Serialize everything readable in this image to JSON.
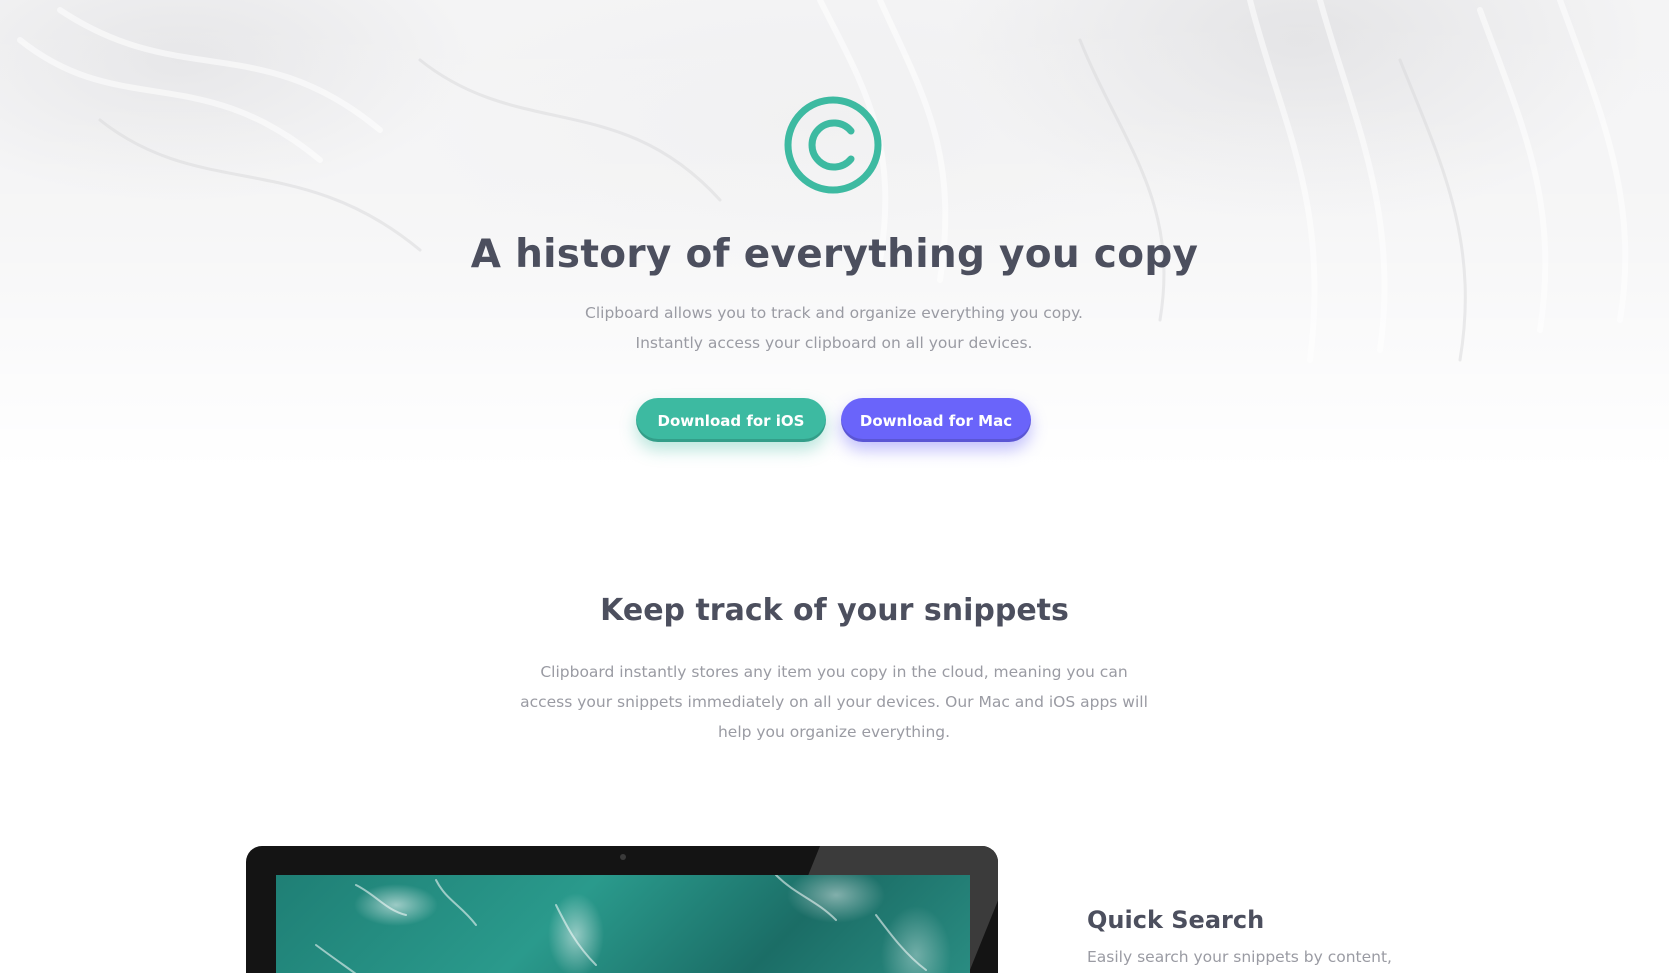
{
  "hero": {
    "logo_icon": "copyright-c-icon",
    "title": "A history of everything you copy",
    "description": "Clipboard allows you to track and organize everything you copy. Instantly access your clipboard on all your devices.",
    "buttons": [
      {
        "label": "Download for iOS",
        "color": "#3dbaa1"
      },
      {
        "label": "Download for Mac",
        "color": "#6a64fa"
      }
    ]
  },
  "snippets": {
    "title": "Keep track of your snippets",
    "description": "Clipboard instantly stores any item you copy in the cloud, meaning you can access your snippets immediately on all your devices. Our Mac and iOS apps will help you organize everything."
  },
  "features": [
    {
      "title": "Quick Search",
      "description": "Easily search your snippets by content,"
    }
  ],
  "colors": {
    "heading": "#4c4f5e",
    "body": "#9a9ba3",
    "strong_cyan": "#3dbaa1",
    "light_blue": "#6a64fa"
  }
}
